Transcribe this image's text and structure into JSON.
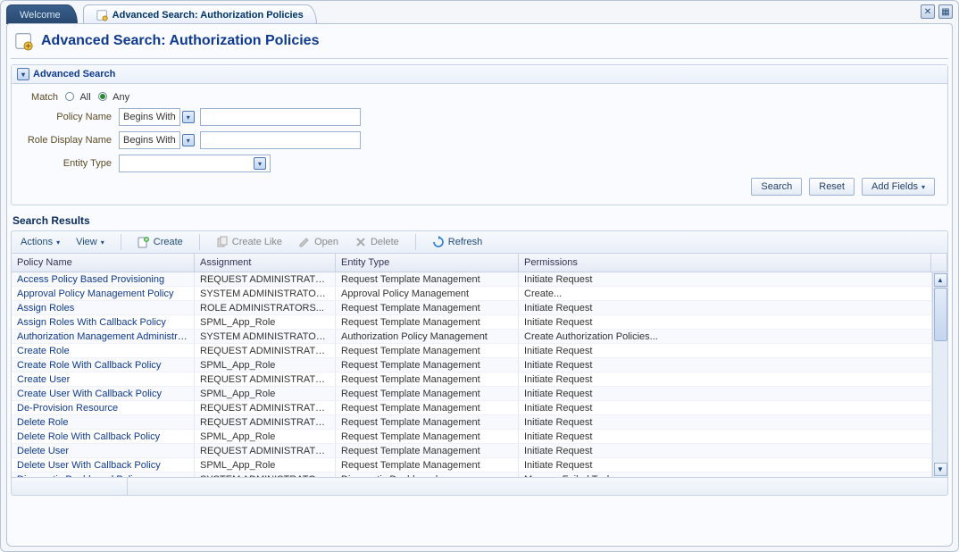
{
  "tabs": {
    "welcome": "Welcome",
    "active_label": "Advanced Search: Authorization Policies"
  },
  "page_title": "Advanced Search: Authorization Policies",
  "adv": {
    "panel_title": "Advanced Search",
    "match_label": "Match",
    "all_label": "All",
    "any_label": "Any",
    "fields": {
      "policy_name": {
        "label": "Policy Name",
        "op": "Begins With",
        "value": ""
      },
      "role_display_name": {
        "label": "Role Display Name",
        "op": "Begins With",
        "value": ""
      },
      "entity_type": {
        "label": "Entity Type",
        "value": ""
      }
    },
    "buttons": {
      "search": "Search",
      "reset": "Reset",
      "add_fields": "Add Fields"
    }
  },
  "results": {
    "title": "Search Results",
    "toolbar": {
      "actions": "Actions",
      "view": "View",
      "create": "Create",
      "create_like": "Create Like",
      "open": "Open",
      "delete": "Delete",
      "refresh": "Refresh"
    },
    "columns": {
      "policy_name": "Policy Name",
      "assignment": "Assignment",
      "entity_type": "Entity Type",
      "permissions": "Permissions"
    },
    "rows": [
      {
        "policy": "Access Policy Based Provisioning",
        "assign": "REQUEST ADMINISTRATORS",
        "entity": "Request Template Management",
        "perm": "Initiate Request"
      },
      {
        "policy": "Approval Policy Management Policy",
        "assign": "SYSTEM ADMINISTRATORS...",
        "entity": "Approval Policy Management",
        "perm": "Create..."
      },
      {
        "policy": "Assign Roles",
        "assign": "ROLE ADMINISTRATORS...",
        "entity": "Request Template Management",
        "perm": "Initiate Request"
      },
      {
        "policy": "Assign Roles With Callback Policy",
        "assign": "SPML_App_Role",
        "entity": "Request Template Management",
        "perm": "Initiate Request"
      },
      {
        "policy": "Authorization Management Administration",
        "assign": "SYSTEM ADMINISTRATORS",
        "entity": "Authorization Policy Management",
        "perm": "Create Authorization Policies..."
      },
      {
        "policy": "Create Role",
        "assign": "REQUEST ADMINISTRATORS",
        "entity": "Request Template Management",
        "perm": "Initiate Request"
      },
      {
        "policy": "Create Role With Callback Policy",
        "assign": "SPML_App_Role",
        "entity": "Request Template Management",
        "perm": "Initiate Request"
      },
      {
        "policy": "Create User",
        "assign": "REQUEST ADMINISTRATORS",
        "entity": "Request Template Management",
        "perm": "Initiate Request"
      },
      {
        "policy": "Create User With Callback Policy",
        "assign": "SPML_App_Role",
        "entity": "Request Template Management",
        "perm": "Initiate Request"
      },
      {
        "policy": "De-Provision Resource",
        "assign": "REQUEST ADMINISTRATORS",
        "entity": "Request Template Management",
        "perm": "Initiate Request"
      },
      {
        "policy": "Delete Role",
        "assign": "REQUEST ADMINISTRATORS",
        "entity": "Request Template Management",
        "perm": "Initiate Request"
      },
      {
        "policy": "Delete Role With Callback Policy",
        "assign": "SPML_App_Role",
        "entity": "Request Template Management",
        "perm": "Initiate Request"
      },
      {
        "policy": "Delete User",
        "assign": "REQUEST ADMINISTRATORS",
        "entity": "Request Template Management",
        "perm": "Initiate Request"
      },
      {
        "policy": "Delete User With Callback Policy",
        "assign": "SPML_App_Role",
        "entity": "Request Template Management",
        "perm": "Initiate Request"
      },
      {
        "policy": "Diagnostic Dashboard Policy",
        "assign": "SYSTEM ADMINISTRATORS",
        "entity": "Diagnostic Dashboard",
        "perm": "Manage Failed Tasks"
      }
    ]
  }
}
